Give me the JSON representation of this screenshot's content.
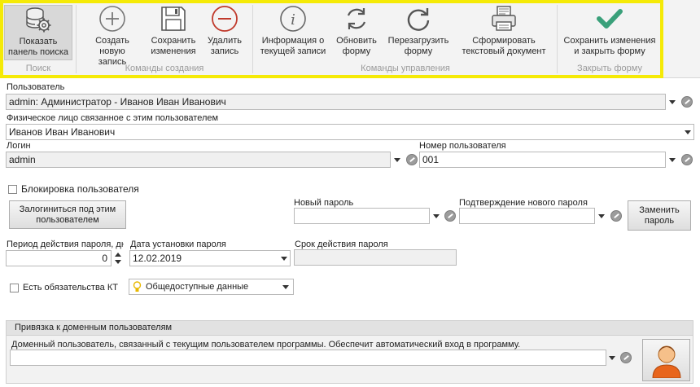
{
  "ribbon": {
    "groups": [
      {
        "caption": "Поиск"
      },
      {
        "caption": "Команды создания"
      },
      {
        "caption": "Команды управления"
      },
      {
        "caption": "Закрыть форму"
      }
    ],
    "buttons": {
      "show_search": {
        "line1": "Показать",
        "line2": "панель поиска"
      },
      "create": {
        "line1": "Создать",
        "line2": "новую запись"
      },
      "save": {
        "line1": "Сохранить",
        "line2": "изменения"
      },
      "delete": {
        "line1": "Удалить",
        "line2": "запись"
      },
      "info": {
        "line1": "Информация о",
        "line2": "текущей записи"
      },
      "refresh": {
        "line1": "Обновить",
        "line2": "форму"
      },
      "reload": {
        "line1": "Перезагрузить",
        "line2": "форму"
      },
      "text_doc": {
        "line1": "Сформировать",
        "line2": "текстовый документ"
      },
      "save_close": {
        "line1": "Сохранить изменения",
        "line2": "и закрыть форму"
      }
    },
    "highlight_color": "#f5ea06"
  },
  "form": {
    "user_label": "Пользователь",
    "user_value": "admin: Администратор - Иванов Иван Иванович",
    "person_label": "Физическое лицо связанное с этим пользователем",
    "person_value": "Иванов Иван Иванович",
    "login_label": "Логин",
    "login_value": "admin",
    "user_number_label": "Номер пользователя",
    "user_number_value": "001",
    "block_user_label": "Блокировка пользователя",
    "login_as_button": {
      "line1": "Залогиниться под этим",
      "line2": "пользователем"
    },
    "new_password_label": "Новый пароль",
    "new_password_value": "",
    "confirm_password_label": "Подтверждение нового пароля",
    "confirm_password_value": "",
    "change_password_button": {
      "line1": "Заменить",
      "line2": "пароль"
    },
    "period_label": "Период действия пароля, дн",
    "period_value": "0",
    "install_date_label": "Дата установки пароля",
    "install_date_value": "12.02.2019",
    "expiry_label": "Срок действия пароля",
    "expiry_value": "",
    "kt_label": "Есть обязательства КТ",
    "access_value": "Общедоступные данные"
  },
  "domain": {
    "header": "Привязка к доменным пользователям",
    "description": "Доменный пользователь, связанный с текущим пользователем программы. Обеспечит автоматический вход в программу.",
    "value": ""
  },
  "colors": {
    "accent_check": "#3aa07a",
    "plus_circle": "#777777",
    "delete_red": "#c0392b",
    "avatar_orange": "#e8651c"
  }
}
